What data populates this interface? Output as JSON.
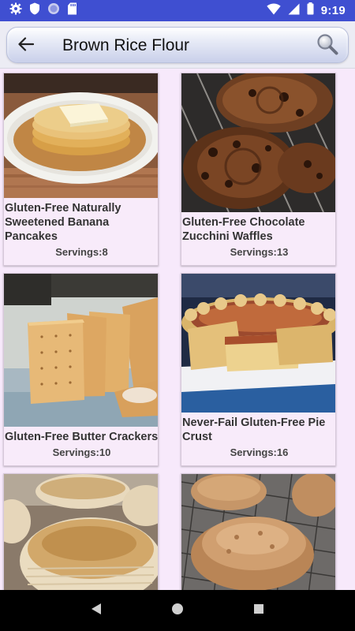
{
  "status_bar": {
    "time": "9:19",
    "left_icons": [
      "gear-icon",
      "shield-icon",
      "circle-icon",
      "sd-card-icon"
    ],
    "right_icons": [
      "wifi-icon",
      "signal-icon",
      "battery-icon"
    ]
  },
  "header": {
    "title": "Brown Rice Flour",
    "back_icon": "arrow-left-icon",
    "search_icon": "magnifier-icon"
  },
  "recipes": [
    {
      "title": "Gluten-Free Naturally Sweetened Banana Pancakes",
      "servings": "Servings:8"
    },
    {
      "title": "Gluten-Free Chocolate Zucchini Waffles",
      "servings": "Servings:13"
    },
    {
      "title": "Gluten-Free Butter Crackers",
      "servings": "Servings:10"
    },
    {
      "title": "Never-Fail Gluten-Free Pie Crust",
      "servings": "Servings:16"
    },
    {
      "title": "",
      "servings": ""
    },
    {
      "title": "",
      "servings": ""
    }
  ],
  "nav_bar": {
    "buttons": [
      "back-triangle-icon",
      "home-circle-icon",
      "recents-square-icon"
    ]
  }
}
